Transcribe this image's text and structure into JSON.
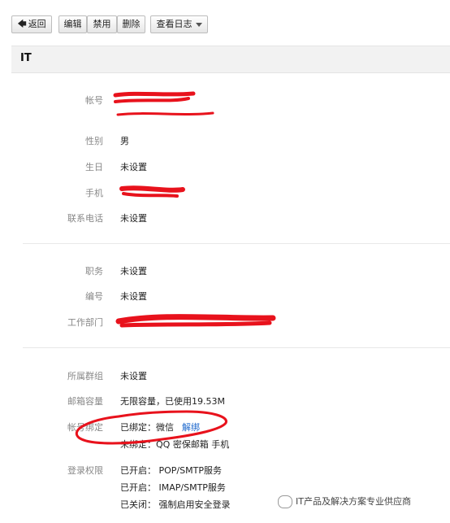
{
  "toolbar": {
    "back": "返回",
    "edit": "编辑",
    "disable": "禁用",
    "delete": "删除",
    "view_log": "查看日志"
  },
  "header": {
    "title": "IT"
  },
  "section1": {
    "account_label": "帐号",
    "gender_label": "性别",
    "gender_value": "男",
    "birthday_label": "生日",
    "birthday_value": "未设置",
    "mobile_label": "手机",
    "phone_label": "联系电话",
    "phone_value": "未设置"
  },
  "section2": {
    "position_label": "职务",
    "position_value": "未设置",
    "number_label": "编号",
    "number_value": "未设置",
    "department_label": "工作部门"
  },
  "section3": {
    "group_label": "所属群组",
    "group_value": "未设置",
    "mailbox_label": "邮箱容量",
    "mailbox_value": "无限容量，已使用19.53M",
    "binding_label": "帐号绑定",
    "bound_value": "已绑定：微信",
    "unbind_link": "解绑",
    "unbound_value": "未绑定：QQ 密保邮箱 手机",
    "login_label": "登录权限",
    "login_pop": "已开启： POP/SMTP服务",
    "login_imap": "已开启： IMAP/SMTP服务",
    "login_secure": "已关闭： 强制启用安全登录"
  },
  "watermark": {
    "text": "IT产品及解决方案专业供应商"
  },
  "colors": {
    "redaction": "#e8121c",
    "link": "#1a66cc"
  }
}
